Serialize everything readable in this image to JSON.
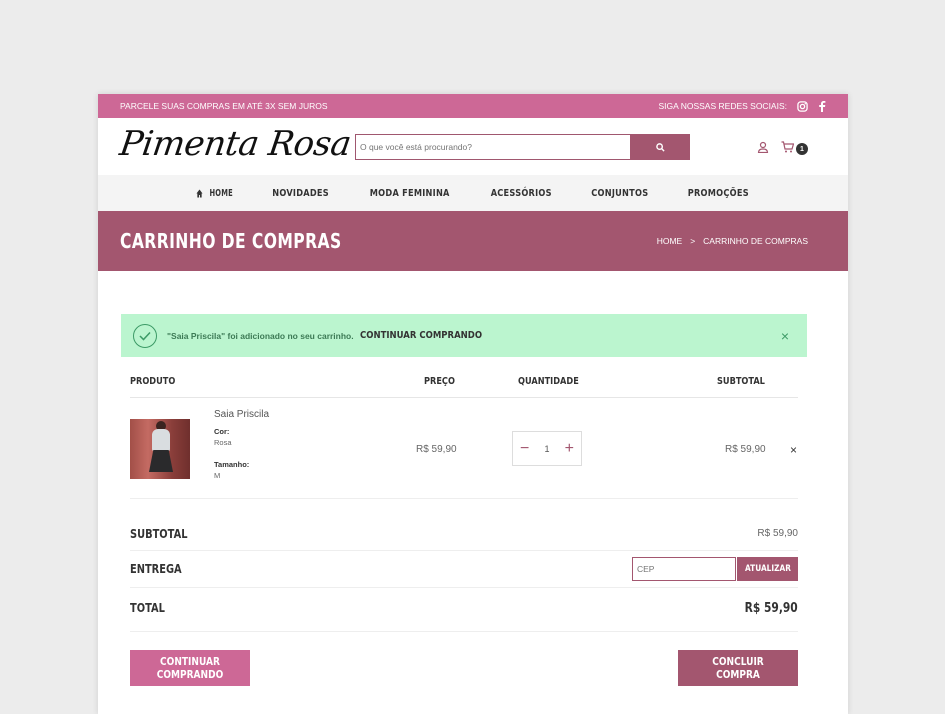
{
  "topbar": {
    "promo": "PARCELE SUAS COMPRAS EM ATÉ 3X SEM JUROS",
    "social_label": "SIGA NOSSAS REDES SOCIAIS:"
  },
  "header": {
    "logo": "Pimenta Rosa",
    "search_placeholder": "O que você está procurando?",
    "cart_count": "1"
  },
  "nav": {
    "items": [
      "HOME",
      "NOVIDADES",
      "MODA FEMININA",
      "ACESSÓRIOS",
      "CONJUNTOS",
      "PROMOÇÕES"
    ]
  },
  "banner": {
    "title": "CARRINHO DE COMPRAS",
    "breadcrumb": [
      "HOME",
      "CARRINHO DE COMPRAS"
    ],
    "separator": ">"
  },
  "notice": {
    "message": "\"Saia Priscila\" foi adicionado no seu carrinho.",
    "link": "CONTINUAR COMPRANDO",
    "close": "×"
  },
  "table": {
    "headers": [
      "PRODUTO",
      "PREÇO",
      "QUANTIDADE",
      "SUBTOTAL"
    ],
    "item": {
      "name": "Saia Priscila",
      "attr1_label": "Cor:",
      "attr1_value": "Rosa",
      "attr2_label": "Tamanho:",
      "attr2_value": "M",
      "price": "R$ 59,90",
      "quantity": "1",
      "subtotal": "R$ 59,90",
      "remove": "×"
    }
  },
  "totals": {
    "subtotal_label": "SUBTOTAL",
    "subtotal_value": "R$ 59,90",
    "shipping_label": "ENTREGA",
    "cep_placeholder": "CEP",
    "update_button": "ATUALIZAR",
    "total_label": "TOTAL",
    "total_value": "R$ 59,90"
  },
  "actions": {
    "continue": "CONTINUAR COMPRANDO",
    "checkout": "CONCLUIR COMPRA"
  },
  "colors": {
    "topbar": "#cd6896",
    "primary": "#a3566f",
    "notice_bg": "#bbf5cf"
  }
}
